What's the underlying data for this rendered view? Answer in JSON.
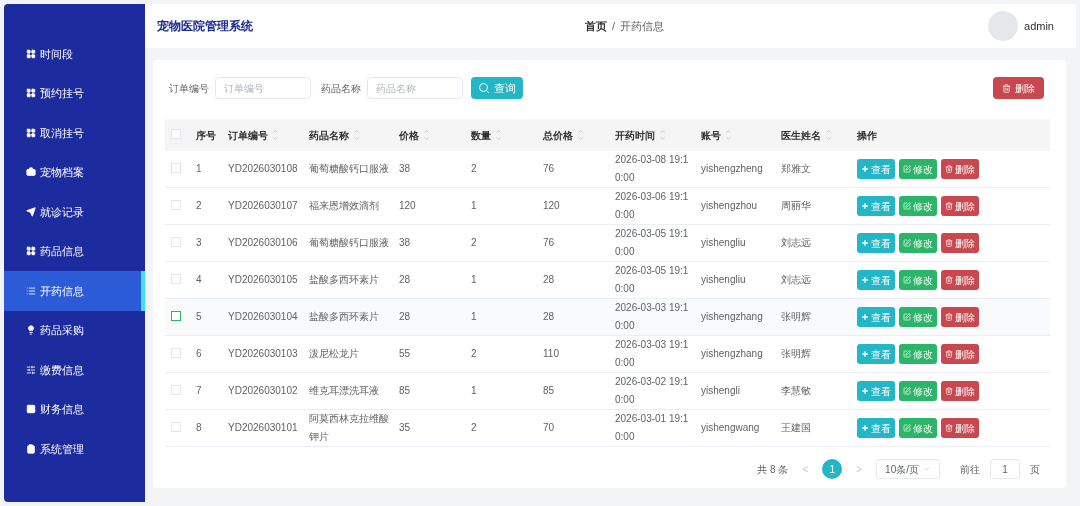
{
  "sidebar": {
    "items": [
      {
        "label": "时间段",
        "selected": false
      },
      {
        "label": "预约挂号",
        "selected": false
      },
      {
        "label": "取消挂号",
        "selected": false
      },
      {
        "label": "宠物档案",
        "selected": false
      },
      {
        "label": "就诊记录",
        "selected": false
      },
      {
        "label": "药品信息",
        "selected": false
      },
      {
        "label": "开药信息",
        "selected": true
      },
      {
        "label": "药品采购",
        "selected": false
      },
      {
        "label": "缴费信息",
        "selected": false
      },
      {
        "label": "财务信息",
        "selected": false
      },
      {
        "label": "系统管理",
        "selected": false
      }
    ]
  },
  "header": {
    "title": "宠物医院管理系统",
    "breadcrumb": [
      "首页",
      "开药信息"
    ],
    "separator": "/",
    "user": "admin"
  },
  "search": {
    "fields": [
      {
        "label": "订单编号",
        "placeholder": "订单编号"
      },
      {
        "label": "药品名称",
        "placeholder": "药品名称"
      }
    ],
    "search_button": "查询",
    "delete_button": "删除"
  },
  "table": {
    "columns": [
      {
        "label": "序号",
        "sortable": false
      },
      {
        "label": "订单编号",
        "sortable": true
      },
      {
        "label": "药品名称",
        "sortable": true
      },
      {
        "label": "价格",
        "sortable": true
      },
      {
        "label": "数量",
        "sortable": true
      },
      {
        "label": "总价格",
        "sortable": true
      },
      {
        "label": "开药时间",
        "sortable": true
      },
      {
        "label": "账号",
        "sortable": true
      },
      {
        "label": "医生姓名",
        "sortable": true
      },
      {
        "label": "操作",
        "sortable": false
      }
    ],
    "select_all_checked": false,
    "rows": [
      {
        "checked": false,
        "hovered": false,
        "actions": [
          "查看",
          "修改",
          "删除"
        ],
        "cells": [
          "1",
          "YD2026030108",
          "葡萄糖酸钙口服液",
          "38",
          "2",
          "76",
          "2026-03-08 19:10:00",
          "yishengzheng",
          "郑雅文"
        ]
      },
      {
        "checked": false,
        "hovered": false,
        "actions": [
          "查看",
          "修改",
          "删除"
        ],
        "cells": [
          "2",
          "YD2026030107",
          "福来恩增效滴剂",
          "120",
          "1",
          "120",
          "2026-03-06 19:10:00",
          "yishengzhou",
          "周丽华"
        ]
      },
      {
        "checked": false,
        "hovered": false,
        "actions": [
          "查看",
          "修改",
          "删除"
        ],
        "cells": [
          "3",
          "YD2026030106",
          "葡萄糖酸钙口服液",
          "38",
          "2",
          "76",
          "2026-03-05 19:10:00",
          "yishengliu",
          "刘志远"
        ]
      },
      {
        "checked": false,
        "hovered": false,
        "actions": [
          "查看",
          "修改",
          "删除"
        ],
        "cells": [
          "4",
          "YD2026030105",
          "盐酸多西环素片",
          "28",
          "1",
          "28",
          "2026-03-05 19:10:00",
          "yishengliu",
          "刘志远"
        ]
      },
      {
        "checked": false,
        "hovered": true,
        "actions": [
          "查看",
          "修改",
          "删除"
        ],
        "cells": [
          "5",
          "YD2026030104",
          "盐酸多西环素片",
          "28",
          "1",
          "28",
          "2026-03-03 19:10:00",
          "yishengzhang",
          "张明辉"
        ]
      },
      {
        "checked": false,
        "hovered": false,
        "actions": [
          "查看",
          "修改",
          "删除"
        ],
        "cells": [
          "6",
          "YD2026030103",
          "泼尼松龙片",
          "55",
          "2",
          "110",
          "2026-03-03 19:10:00",
          "yishengzhang",
          "张明辉"
        ]
      },
      {
        "checked": false,
        "hovered": false,
        "actions": [
          "查看",
          "修改",
          "删除"
        ],
        "cells": [
          "7",
          "YD2026030102",
          "维克耳漂洗耳液",
          "85",
          "1",
          "85",
          "2026-03-02 19:10:00",
          "yishengli",
          "李慧敏"
        ]
      },
      {
        "checked": false,
        "hovered": false,
        "actions": [
          "查看",
          "修改",
          "删除"
        ],
        "cells": [
          "8",
          "YD2026030101",
          "阿莫西林克拉维酸钾片",
          "35",
          "2",
          "70",
          "2026-03-01 19:10:00",
          "yishengwang",
          "王建国"
        ]
      }
    ]
  },
  "pagination": {
    "total": "共 8 条",
    "prev": "<",
    "pages": [
      {
        "label": "1",
        "selected": true
      }
    ],
    "next": ">",
    "page_size": "10条/页",
    "goto_label": "前往",
    "goto_value": "1",
    "goto_suffix": "页"
  }
}
